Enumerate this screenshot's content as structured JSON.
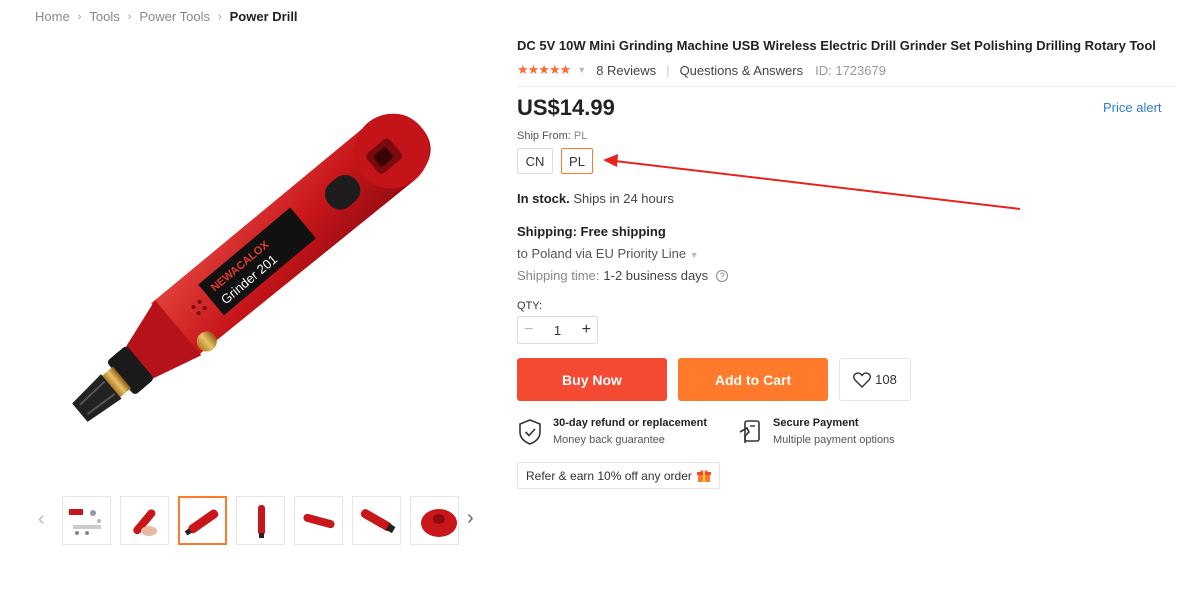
{
  "breadcrumb": {
    "items": [
      "Home",
      "Tools",
      "Power Tools"
    ],
    "current": "Power Drill"
  },
  "product": {
    "title": "DC 5V 10W Mini Grinding Machine USB Wireless Electric Drill Grinder Set Polishing Drilling Rotary Tool",
    "rating_stars": 5,
    "reviews_label": "8 Reviews",
    "qa_label": "Questions & Answers",
    "id_label": "ID: 1723679",
    "price": "US$14.99",
    "price_alert_label": "Price alert",
    "image_brand_text": "NEWACALOX",
    "image_model_text": "Grinder 201"
  },
  "ship_from": {
    "label": "Ship From:",
    "selected": "PL",
    "options": [
      "CN",
      "PL"
    ]
  },
  "stock": {
    "status": "In stock.",
    "detail": "Ships in 24 hours"
  },
  "shipping": {
    "heading": "Shipping: Free shipping",
    "destination": "to Poland via EU Priority Line",
    "time_label": "Shipping time:",
    "time_value": "1-2 business days"
  },
  "quantity": {
    "label": "QTY:",
    "value": "1",
    "minus": "−",
    "plus": "+"
  },
  "actions": {
    "buy_now": "Buy Now",
    "add_to_cart": "Add to Cart",
    "wishlist_count": "108"
  },
  "guarantees": [
    {
      "title": "30-day refund or replacement",
      "subtitle": "Money back guarantee",
      "icon": "shield-check-icon"
    },
    {
      "title": "Secure Payment",
      "subtitle": "Multiple payment options",
      "icon": "secure-payment-icon"
    }
  ],
  "refer": {
    "label": "Refer & earn 10% off any order",
    "icon": "gift-icon"
  },
  "thumbnails": {
    "count": 7,
    "active_index": 2,
    "prev_icon": "chevron-left-icon",
    "next_icon": "chevron-right-icon"
  },
  "colors": {
    "accent_orange": "#ff7b2b",
    "buy_red": "#f44a32",
    "star_orange": "#ff6a33",
    "link_blue": "#2e7dd1",
    "annotation_arrow": "#e8231c"
  }
}
